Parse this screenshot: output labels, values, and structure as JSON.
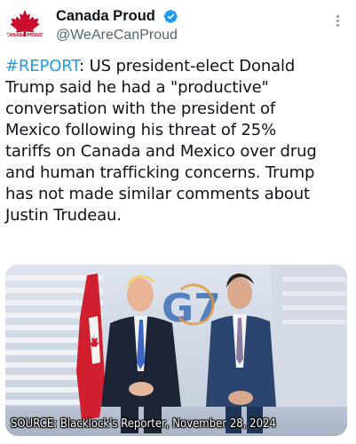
{
  "account": {
    "display_name": "Canada Proud",
    "handle": "@WeAreCanProud",
    "avatar_logo_text": "CANADA PROUD",
    "verified": true
  },
  "tweet": {
    "hashtag": "#REPORT",
    "lines": [
      ": US president-elect Donald",
      "Trump said he had a \"productive\"",
      "conversation with the president of",
      "Mexico following his threat of 25%",
      "tariffs on Canada and Mexico over drug",
      "and human trafficking concerns. Trump",
      "has not made similar comments about",
      "Justin Trudeau."
    ]
  },
  "media": {
    "caption": "SOURCE: Blacklock's Reporter, November 28, 2024",
    "backdrop_text": "G7"
  },
  "icons": {
    "verified": "verified-badge-icon",
    "more": "more-options-icon",
    "avatar": "maple-leaf-logo"
  },
  "colors": {
    "verified_badge": "#1d9bf0",
    "hashtag": "#1d9bf0",
    "handle": "#536471",
    "maple_leaf": "#c8102e"
  }
}
